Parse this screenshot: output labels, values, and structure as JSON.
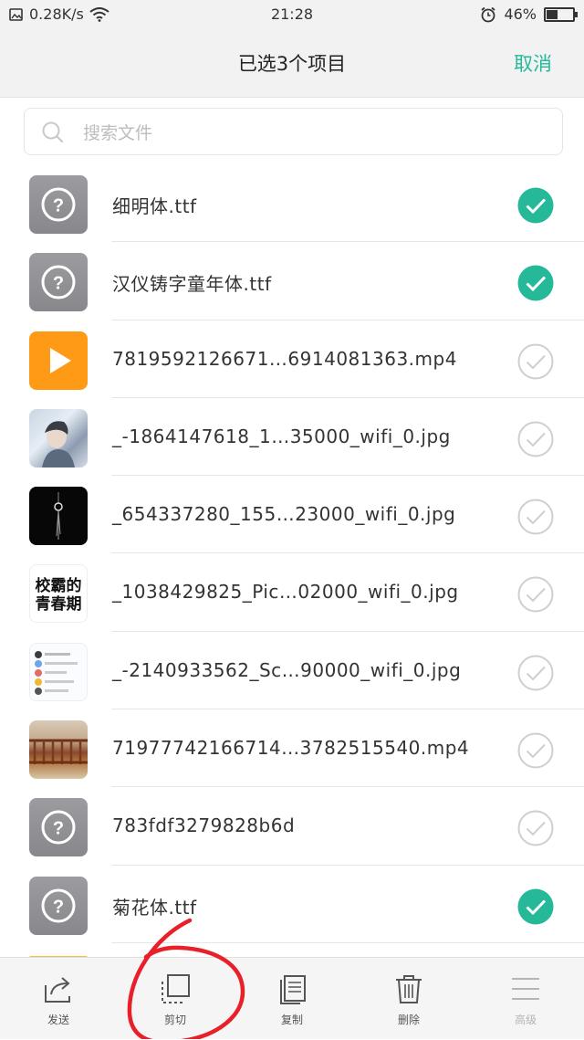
{
  "status_bar": {
    "network_speed": "0.28K/s",
    "time": "21:28",
    "battery_percent": "46%",
    "battery_level": 0.46,
    "icons": [
      "photo-icon",
      "wifi-icon",
      "alarm-icon",
      "battery-icon"
    ]
  },
  "header": {
    "title": "已选3个项目",
    "cancel_label": "取消"
  },
  "search": {
    "placeholder": "搜索文件"
  },
  "files": [
    {
      "name": "细明体.ttf",
      "type": "unknown",
      "selected": true
    },
    {
      "name": "汉仪铸字童年体.ttf",
      "type": "unknown",
      "selected": true
    },
    {
      "name": "7819592126671…6914081363.mp4",
      "type": "video",
      "selected": false
    },
    {
      "name": "_-1864147618_1…35000_wifi_0.jpg",
      "type": "image",
      "selected": false
    },
    {
      "name": "_654337280_155…23000_wifi_0.jpg",
      "type": "image",
      "selected": false
    },
    {
      "name": "_1038429825_Pic…02000_wifi_0.jpg",
      "type": "image",
      "selected": false
    },
    {
      "name": "_-2140933562_Sc…90000_wifi_0.jpg",
      "type": "image",
      "selected": false
    },
    {
      "name": "71977742166714…3782515540.mp4",
      "type": "video",
      "selected": false
    },
    {
      "name": "783fdf3279828b6d",
      "type": "unknown",
      "selected": false
    },
    {
      "name": "菊花体.ttf",
      "type": "unknown",
      "selected": true
    }
  ],
  "thumbnail_text": {
    "poster": "校霸的青春期"
  },
  "toolbar": {
    "send": "发送",
    "cut": "剪切",
    "copy": "复制",
    "delete": "删除",
    "more": "高级"
  },
  "colors": {
    "accent": "#25b99a",
    "annotation": "#e8202a",
    "video_icon": "#ff9a17"
  }
}
